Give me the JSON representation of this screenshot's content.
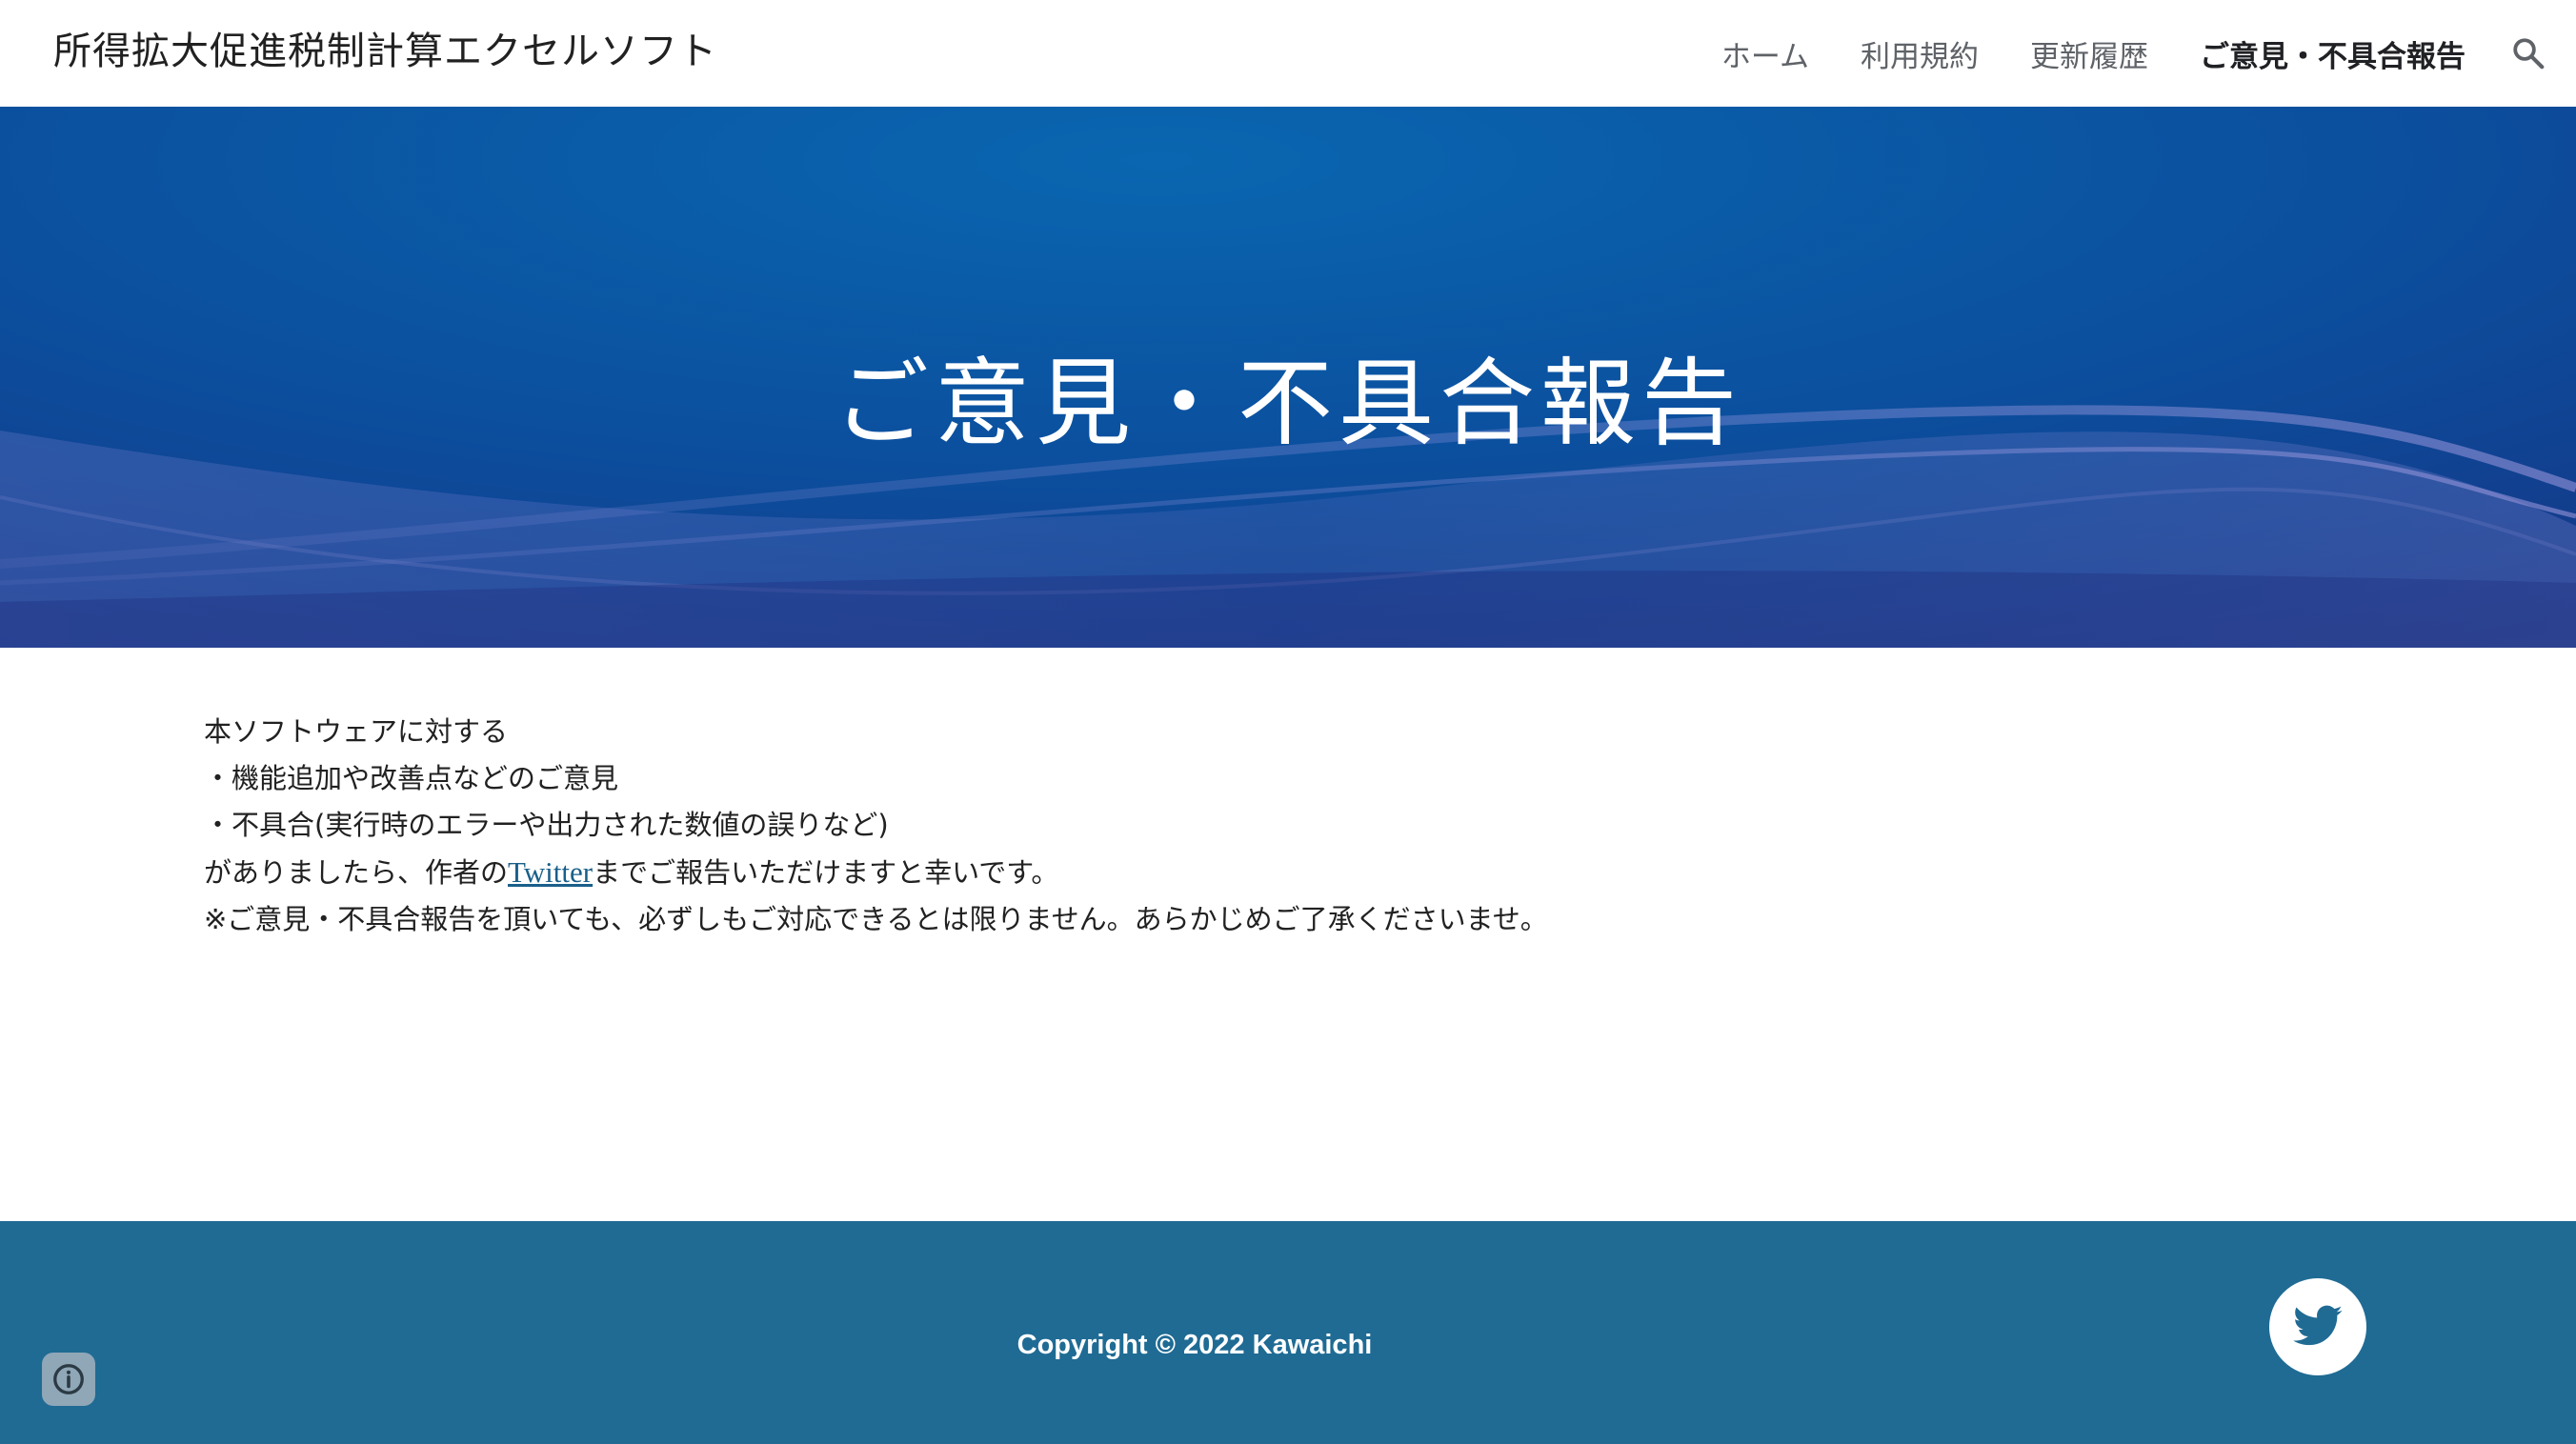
{
  "header": {
    "site_title": "所得拡大促進税制計算エクセルソフト",
    "nav": [
      {
        "label": "ホーム"
      },
      {
        "label": "利用規約"
      },
      {
        "label": "更新履歴"
      },
      {
        "label": "ご意見・不具合報告"
      }
    ],
    "active_nav": "ご意見・不具合報告",
    "search_icon": "search-icon"
  },
  "hero": {
    "title": "ご意見・不具合報告"
  },
  "content": {
    "line1": "本ソフトウェアに対する",
    "line2": "・機能追加や改善点などのご意見",
    "line3": "・不具合(実行時のエラーや出力された数値の誤りなど)",
    "line4_before": "がありましたら、作者の",
    "line4_link": "Twitter",
    "line4_after": "までご報告いただけますと幸いです。",
    "line5": "※ご意見・不具合報告を頂いても、必ずしもご対応できるとは限りません。あらかじめご了承くださいませ。"
  },
  "footer": {
    "copyright": "Copyright © 2022 Kawaichi",
    "twitter_icon": "twitter-icon",
    "info_icon": "info-icon"
  },
  "colors": {
    "footer_bg": "#1f6b94",
    "hero_bg": "#0b4f9e",
    "link": "#1a5f8a"
  }
}
